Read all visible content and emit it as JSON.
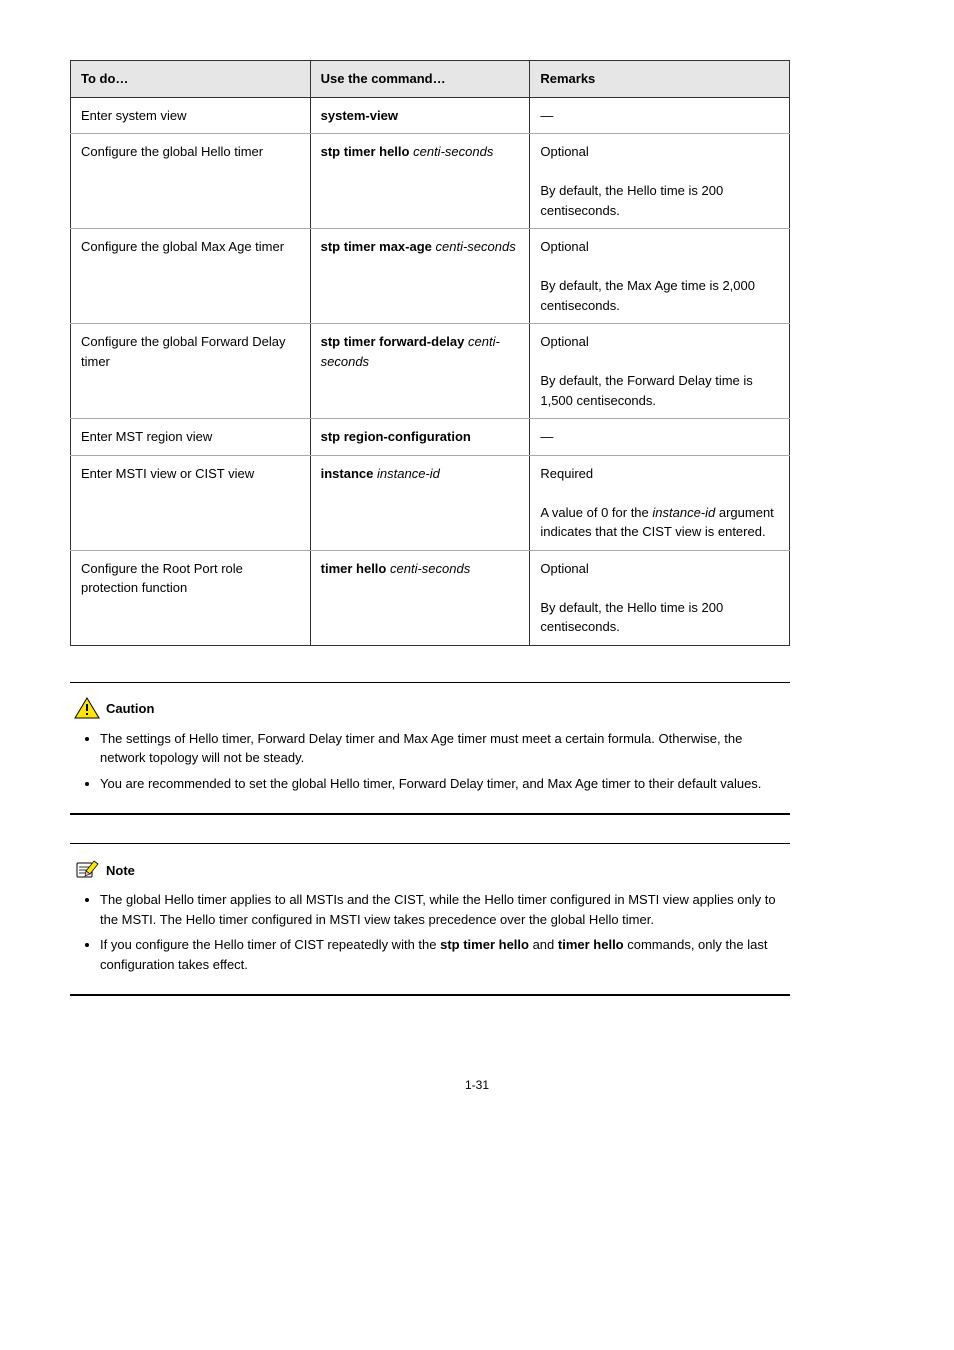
{
  "table": {
    "headers": [
      "To do…",
      "Use the command…",
      "Remarks"
    ],
    "rows": [
      {
        "todo": "Enter system view",
        "cmd_html": "<b>system-view</b>",
        "remarks": "—"
      },
      {
        "todo": "Configure the global Hello timer",
        "cmd_html": "<b>stp timer hello</b> <i>centi-seconds</i>",
        "remarks": "Optional\n\nBy default, the Hello time is 200 centiseconds."
      },
      {
        "todo": "Configure the global Max Age timer",
        "cmd_html": "<b>stp timer max-age</b> <i>centi-seconds</i>",
        "remarks": "Optional\n\nBy default, the Max Age time is 2,000 centiseconds."
      },
      {
        "todo": "Configure the global Forward Delay timer",
        "cmd_html": "<b>stp timer forward-delay</b> <i>centi-seconds</i>",
        "remarks": "Optional\n\nBy default, the Forward Delay time is 1,500 centiseconds."
      },
      {
        "todo": "Enter MST region view",
        "cmd_html": "<b>stp region-configuration</b>",
        "remarks": "—"
      },
      {
        "todo": "Enter MSTI view or CIST view",
        "cmd_html": "<b>instance</b> <i>instance-id</i>",
        "remarks": "Required\n\nA value of 0 for the <i>instance-id</i> argument indicates that the CIST view is entered."
      },
      {
        "todo": "Configure the Root Port role protection function",
        "cmd_html": "<b>timer hello</b> <i>centi-seconds</i>",
        "remarks": "Optional\n\nBy default, the Hello time is 200 centiseconds."
      }
    ]
  },
  "caution": {
    "label": "Caution",
    "items": [
      "The settings of Hello timer, Forward Delay timer and Max Age timer must meet a certain formula. Otherwise, the network topology will not be steady.",
      "You are recommended to set the global Hello timer, Forward Delay timer, and Max Age timer to their default values."
    ]
  },
  "note": {
    "label": "Note",
    "items": [
      "The global Hello timer applies to all MSTIs and the CIST, while the Hello timer configured in MSTI view applies only to the MSTI. The Hello timer configured in MSTI view takes precedence over the global Hello timer.",
      "If you configure the Hello timer of CIST repeatedly with the <b>stp timer hello</b> and <b>timer hello</b> commands, only the last configuration takes effect."
    ]
  },
  "page_number": "1-31"
}
